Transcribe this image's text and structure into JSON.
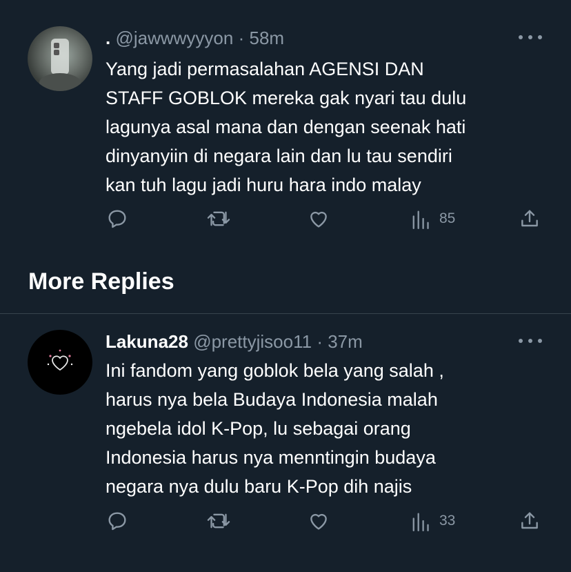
{
  "tweets": [
    {
      "display_name": ".",
      "handle": "@jawwwyyyon",
      "separator": "·",
      "time": "58m",
      "lines": [
        "Yang jadi permasalahan AGENSI DAN",
        "STAFF GOBLOK mereka gak nyari tau dulu",
        "lagunya asal mana dan dengan seenak hati",
        "dinyanyiin di negara lain dan lu tau sendiri",
        "kan tuh lagu jadi huru hara indo malay"
      ],
      "views": "85",
      "avatar_icon": "phone-selfie-avatar"
    },
    {
      "display_name": "Lakuna28",
      "handle": "@prettyjisoo11",
      "separator": "·",
      "time": "37m",
      "lines": [
        "Ini fandom yang goblok bela yang salah ,",
        "harus nya bela Budaya Indonesia malah",
        "ngebela idol K-Pop, lu sebagai orang",
        "Indonesia harus nya menntingin budaya",
        "negara nya dulu baru K-Pop dih najis"
      ],
      "views": "33",
      "avatar_icon": "heart-sparkle-avatar"
    }
  ],
  "section": {
    "title": "More Replies"
  },
  "colors": {
    "background": "#15202b",
    "text": "#ffffff",
    "muted": "#8b98a5",
    "divider": "#38444d"
  }
}
